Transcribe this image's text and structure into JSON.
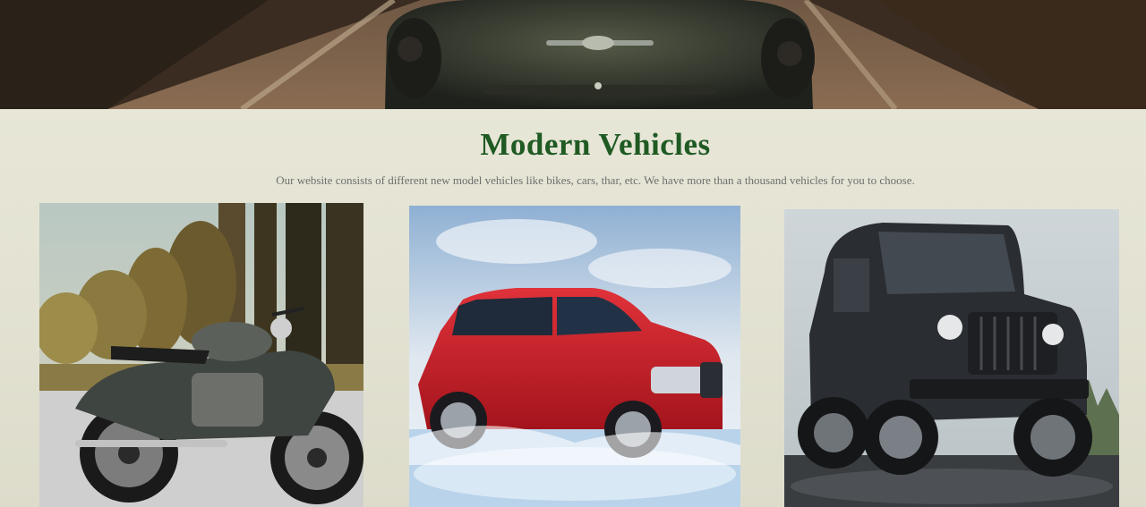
{
  "hero": {
    "image_label": "vintage-car-on-road"
  },
  "section": {
    "title": "Modern Vehicles",
    "description": "Our website consists of different new model vehicles like bikes, cars, thar, etc. We have more than a thousand vehicles for you to choose."
  },
  "cards": [
    {
      "image_label": "motorcycle-image"
    },
    {
      "image_label": "red-suv-image"
    },
    {
      "image_label": "black-thar-jeep-image"
    }
  ],
  "colors": {
    "title": "#1f5a23",
    "description": "#6d6f6c",
    "background": "#e6e5d6"
  }
}
